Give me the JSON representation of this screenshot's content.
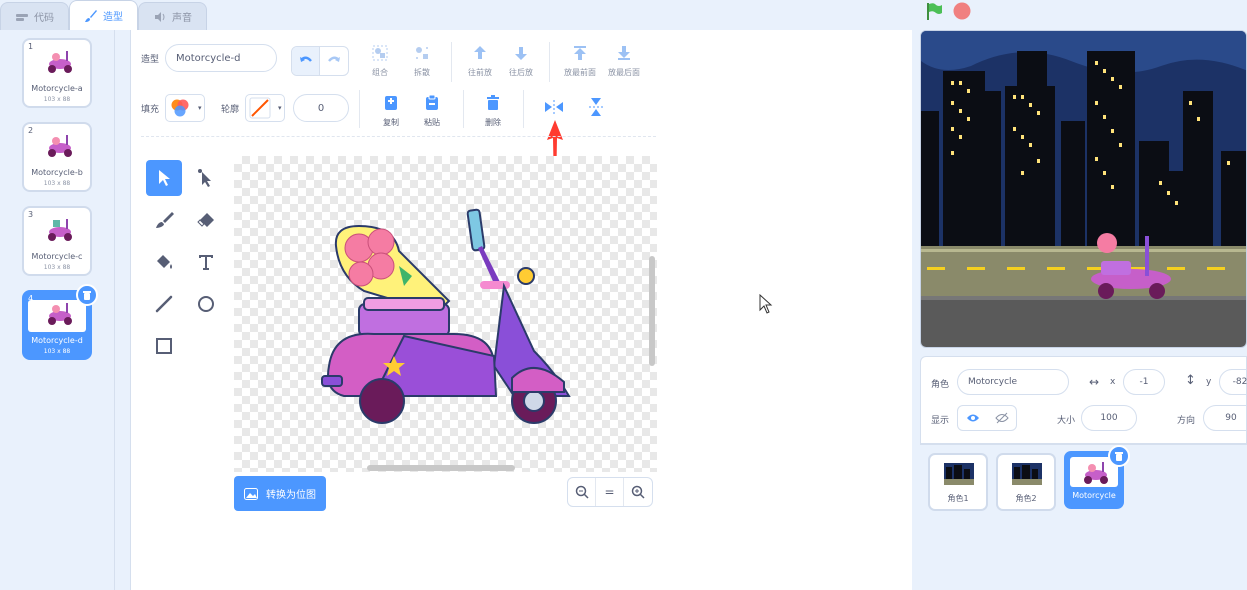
{
  "tabs": [
    {
      "label": "代码",
      "icon": "code-icon"
    },
    {
      "label": "造型",
      "icon": "brush-icon"
    },
    {
      "label": "声音",
      "icon": "speaker-icon"
    }
  ],
  "costumes": [
    {
      "number": "1",
      "name": "Motorcycle-a",
      "size": "103 x 88"
    },
    {
      "number": "2",
      "name": "Motorcycle-b",
      "size": "103 x 88"
    },
    {
      "number": "3",
      "name": "Motorcycle-c",
      "size": "103 x 88"
    },
    {
      "number": "4",
      "name": "Motorcycle-d",
      "size": "103 x 88"
    }
  ],
  "editor": {
    "costume_label": "造型",
    "costume_name": "Motorcycle-d",
    "group": "组合",
    "ungroup": "拆散",
    "forward": "往前放",
    "backward": "往后放",
    "front": "放最前面",
    "back": "放最后面",
    "fill_label": "填充",
    "outline_label": "轮廓",
    "outline_width": "0",
    "copy": "复制",
    "paste": "粘贴",
    "delete": "删除",
    "convert_bitmap": "转换为位图",
    "zoom_reset": "="
  },
  "sprite_info": {
    "sprite_label": "角色",
    "sprite_name": "Motorcycle",
    "x_label": "x",
    "x_value": "-1",
    "y_label": "y",
    "y_value": "-82",
    "show_label": "显示",
    "size_label": "大小",
    "size_value": "100",
    "direction_label": "方向",
    "direction_value": "90"
  },
  "sprites": [
    {
      "name": "角色1"
    },
    {
      "name": "角色2"
    },
    {
      "name": "Motorcycle"
    }
  ],
  "colors": {
    "accent": "#4c97ff",
    "annotation_arrow": "#ff3b30"
  }
}
